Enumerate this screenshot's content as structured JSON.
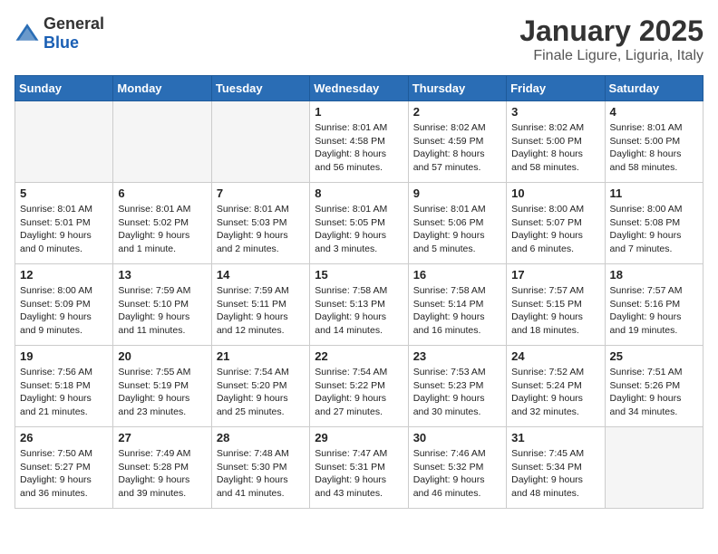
{
  "header": {
    "logo_general": "General",
    "logo_blue": "Blue",
    "month_year": "January 2025",
    "location": "Finale Ligure, Liguria, Italy"
  },
  "weekdays": [
    "Sunday",
    "Monday",
    "Tuesday",
    "Wednesday",
    "Thursday",
    "Friday",
    "Saturday"
  ],
  "weeks": [
    [
      {
        "day": "",
        "info": ""
      },
      {
        "day": "",
        "info": ""
      },
      {
        "day": "",
        "info": ""
      },
      {
        "day": "1",
        "info": "Sunrise: 8:01 AM\nSunset: 4:58 PM\nDaylight: 8 hours\nand 56 minutes."
      },
      {
        "day": "2",
        "info": "Sunrise: 8:02 AM\nSunset: 4:59 PM\nDaylight: 8 hours\nand 57 minutes."
      },
      {
        "day": "3",
        "info": "Sunrise: 8:02 AM\nSunset: 5:00 PM\nDaylight: 8 hours\nand 58 minutes."
      },
      {
        "day": "4",
        "info": "Sunrise: 8:01 AM\nSunset: 5:00 PM\nDaylight: 8 hours\nand 58 minutes."
      }
    ],
    [
      {
        "day": "5",
        "info": "Sunrise: 8:01 AM\nSunset: 5:01 PM\nDaylight: 9 hours\nand 0 minutes."
      },
      {
        "day": "6",
        "info": "Sunrise: 8:01 AM\nSunset: 5:02 PM\nDaylight: 9 hours\nand 1 minute."
      },
      {
        "day": "7",
        "info": "Sunrise: 8:01 AM\nSunset: 5:03 PM\nDaylight: 9 hours\nand 2 minutes."
      },
      {
        "day": "8",
        "info": "Sunrise: 8:01 AM\nSunset: 5:05 PM\nDaylight: 9 hours\nand 3 minutes."
      },
      {
        "day": "9",
        "info": "Sunrise: 8:01 AM\nSunset: 5:06 PM\nDaylight: 9 hours\nand 5 minutes."
      },
      {
        "day": "10",
        "info": "Sunrise: 8:00 AM\nSunset: 5:07 PM\nDaylight: 9 hours\nand 6 minutes."
      },
      {
        "day": "11",
        "info": "Sunrise: 8:00 AM\nSunset: 5:08 PM\nDaylight: 9 hours\nand 7 minutes."
      }
    ],
    [
      {
        "day": "12",
        "info": "Sunrise: 8:00 AM\nSunset: 5:09 PM\nDaylight: 9 hours\nand 9 minutes."
      },
      {
        "day": "13",
        "info": "Sunrise: 7:59 AM\nSunset: 5:10 PM\nDaylight: 9 hours\nand 11 minutes."
      },
      {
        "day": "14",
        "info": "Sunrise: 7:59 AM\nSunset: 5:11 PM\nDaylight: 9 hours\nand 12 minutes."
      },
      {
        "day": "15",
        "info": "Sunrise: 7:58 AM\nSunset: 5:13 PM\nDaylight: 9 hours\nand 14 minutes."
      },
      {
        "day": "16",
        "info": "Sunrise: 7:58 AM\nSunset: 5:14 PM\nDaylight: 9 hours\nand 16 minutes."
      },
      {
        "day": "17",
        "info": "Sunrise: 7:57 AM\nSunset: 5:15 PM\nDaylight: 9 hours\nand 18 minutes."
      },
      {
        "day": "18",
        "info": "Sunrise: 7:57 AM\nSunset: 5:16 PM\nDaylight: 9 hours\nand 19 minutes."
      }
    ],
    [
      {
        "day": "19",
        "info": "Sunrise: 7:56 AM\nSunset: 5:18 PM\nDaylight: 9 hours\nand 21 minutes."
      },
      {
        "day": "20",
        "info": "Sunrise: 7:55 AM\nSunset: 5:19 PM\nDaylight: 9 hours\nand 23 minutes."
      },
      {
        "day": "21",
        "info": "Sunrise: 7:54 AM\nSunset: 5:20 PM\nDaylight: 9 hours\nand 25 minutes."
      },
      {
        "day": "22",
        "info": "Sunrise: 7:54 AM\nSunset: 5:22 PM\nDaylight: 9 hours\nand 27 minutes."
      },
      {
        "day": "23",
        "info": "Sunrise: 7:53 AM\nSunset: 5:23 PM\nDaylight: 9 hours\nand 30 minutes."
      },
      {
        "day": "24",
        "info": "Sunrise: 7:52 AM\nSunset: 5:24 PM\nDaylight: 9 hours\nand 32 minutes."
      },
      {
        "day": "25",
        "info": "Sunrise: 7:51 AM\nSunset: 5:26 PM\nDaylight: 9 hours\nand 34 minutes."
      }
    ],
    [
      {
        "day": "26",
        "info": "Sunrise: 7:50 AM\nSunset: 5:27 PM\nDaylight: 9 hours\nand 36 minutes."
      },
      {
        "day": "27",
        "info": "Sunrise: 7:49 AM\nSunset: 5:28 PM\nDaylight: 9 hours\nand 39 minutes."
      },
      {
        "day": "28",
        "info": "Sunrise: 7:48 AM\nSunset: 5:30 PM\nDaylight: 9 hours\nand 41 minutes."
      },
      {
        "day": "29",
        "info": "Sunrise: 7:47 AM\nSunset: 5:31 PM\nDaylight: 9 hours\nand 43 minutes."
      },
      {
        "day": "30",
        "info": "Sunrise: 7:46 AM\nSunset: 5:32 PM\nDaylight: 9 hours\nand 46 minutes."
      },
      {
        "day": "31",
        "info": "Sunrise: 7:45 AM\nSunset: 5:34 PM\nDaylight: 9 hours\nand 48 minutes."
      },
      {
        "day": "",
        "info": ""
      }
    ]
  ]
}
